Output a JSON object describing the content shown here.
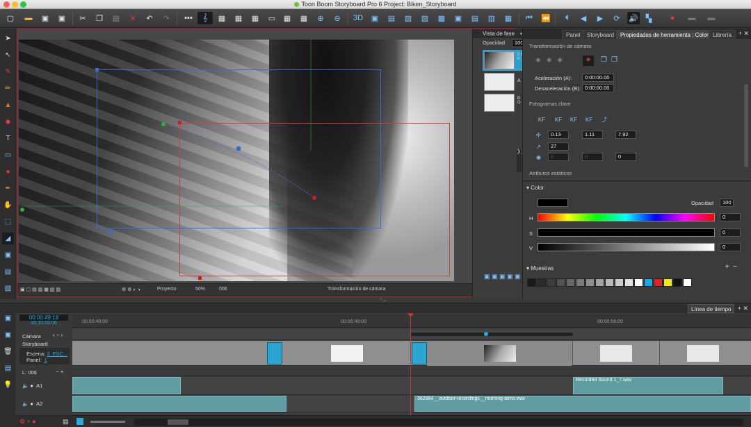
{
  "window": {
    "title": "Toon Boom Storyboard Pro 6 Project: Biken_Storyboard"
  },
  "colors": {
    "accent": "#29a9e0",
    "playhead": "#d43030",
    "selection_border": "#a02828"
  },
  "stage": {
    "phase_view": {
      "title": "Vista de fase",
      "opacity_label": "Opacidad",
      "opacity_value": "100",
      "layers": [
        {
          "label": "0 0 6"
        },
        {
          "label": "A"
        },
        {
          "label": "B G"
        }
      ]
    },
    "status": {
      "view_mode": "Proyecto",
      "zoom": "50%",
      "panel": "006",
      "tool_name": "Transformación de cámara"
    }
  },
  "right_panel": {
    "tabs": [
      {
        "label": "Panel",
        "active": false
      },
      {
        "label": "Storyboard",
        "active": false
      },
      {
        "label": "Propiedades de herramienta : Color",
        "active": true
      },
      {
        "label": "Librería",
        "active": false
      }
    ],
    "camera_transform": {
      "title": "Transformación de cámara",
      "ease_in_label": "Aceleración (A):",
      "ease_in_value": "0:00:00.00",
      "ease_out_label": "Desaceleración (B):",
      "ease_out_value": "0:00:00.00"
    },
    "keyframes": {
      "title": "Fotogramas clave",
      "x": "0.13",
      "y": "1.11",
      "z": "7.92",
      "angle": "27",
      "f1": "0",
      "f2": "0",
      "f3": "0"
    },
    "static_attributes_label": "Atributos estáticos",
    "color": {
      "title": "Color",
      "opacity_label": "Opacidad",
      "opacity_value": "100",
      "h_label": "H",
      "h_value": "0",
      "s_label": "S",
      "s_value": "0",
      "v_label": "V",
      "v_value": "0"
    },
    "swatches": {
      "title": "Muestras",
      "colors": [
        "#1a1a1a",
        "#2c2c2c",
        "#3f3f3f",
        "#525252",
        "#666666",
        "#7a7a7a",
        "#8e8e8e",
        "#a3a3a3",
        "#b8b8b8",
        "#cccccc",
        "#e0e0e0",
        "#ffffff",
        "#1ea6e0",
        "#e02424",
        "#f5e60d",
        "#111111",
        "#ffffff"
      ]
    }
  },
  "timeline": {
    "title": "Línea de tiempo",
    "timecode_current": "00:00:49:19",
    "timecode_total": "00:10:53:06",
    "ruler": [
      "00:00:40:00",
      "00:00:48:00",
      "00:00:56:00"
    ],
    "tracks": {
      "camera": "Cámara",
      "storyboard": "Storyboard",
      "scene_label": "Escena:",
      "scene_value": "3_ESC...",
      "panel_label": "Panel:",
      "panel_value": "1",
      "layer_info": "L: 006",
      "a1": "A1",
      "a2": "A2"
    },
    "audio_clips": {
      "a1_clip2": "Recorded Sound 1_7.wav",
      "a2_clip2": "362984__outdoor-recordings__morning-atmo.wav"
    }
  }
}
